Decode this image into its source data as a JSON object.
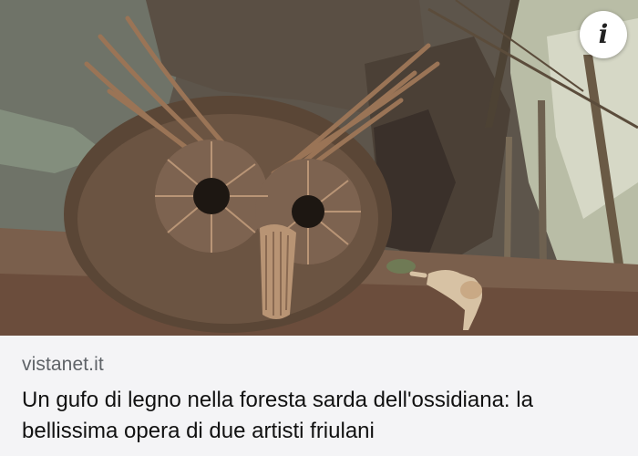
{
  "article": {
    "source": "vistanet.it",
    "headline": "Un gufo di legno nella foresta sarda dell'ossidiana: la bellissima opera di due artisti friulani",
    "image_alt": "Gufo di legno nella foresta"
  },
  "controls": {
    "info_glyph": "i",
    "info_icon": "info-icon"
  },
  "colors": {
    "background": "#f4f4f6",
    "source_text": "#5f6368",
    "headline_text": "#111111",
    "info_button_bg": "#ffffff"
  }
}
